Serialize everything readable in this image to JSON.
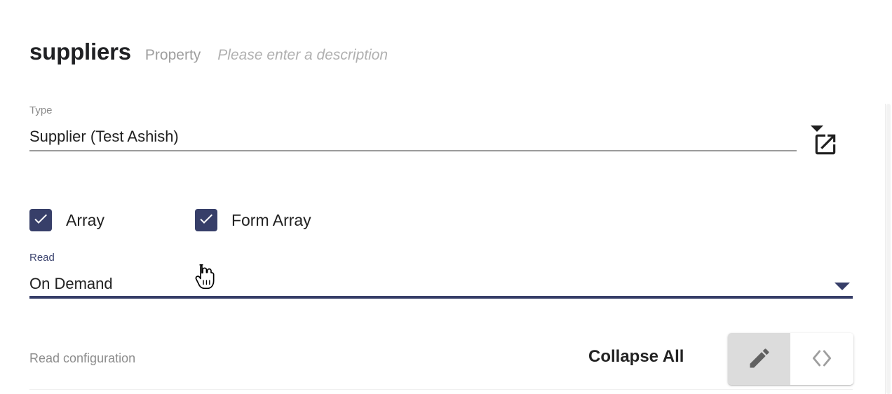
{
  "header": {
    "title": "suppliers",
    "kind": "Property",
    "description_placeholder": "Please enter a description"
  },
  "type_field": {
    "label": "Type",
    "value": "Supplier (Test Ashish)",
    "dropdown_icon": "chevron-down-icon",
    "open_in_new_icon": "open-in-new-icon"
  },
  "checkboxes": [
    {
      "label": "Array",
      "checked": true,
      "icon": "check-icon"
    },
    {
      "label": "Form Array",
      "checked": true,
      "icon": "check-icon"
    }
  ],
  "read_field": {
    "label": "Read",
    "value": "On Demand",
    "dropdown_icon": "chevron-down-icon",
    "active": true
  },
  "read_configuration": {
    "label": "Read configuration",
    "collapse_all_label": "Collapse All"
  },
  "view_toggle": {
    "buttons": [
      {
        "icon": "pencil-icon",
        "selected": true
      },
      {
        "icon": "code-brackets-icon",
        "selected": false
      }
    ]
  },
  "cursor": {
    "icon": "pointer-hand-cursor"
  },
  "colors": {
    "accent_navy": "#373f69",
    "label_gray": "#8c8c8c",
    "text_dark": "#212121",
    "underline_gray": "#9b9b9b",
    "toggle_selected_bg": "#dcdcdc"
  }
}
